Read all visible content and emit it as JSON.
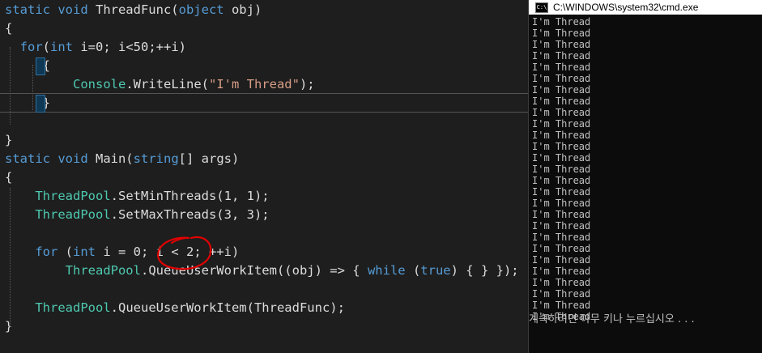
{
  "editor": {
    "lines": [
      [
        {
          "t": "static void ",
          "c": "kw"
        },
        {
          "t": "ThreadFunc(",
          "c": "plain"
        },
        {
          "t": "object",
          "c": "kw"
        },
        {
          "t": " obj)",
          "c": "plain"
        }
      ],
      [
        {
          "t": "{",
          "c": "plain"
        }
      ],
      [
        {
          "t": "  ",
          "c": "plain"
        },
        {
          "t": "for",
          "c": "kw"
        },
        {
          "t": "(",
          "c": "plain"
        },
        {
          "t": "int",
          "c": "kw"
        },
        {
          "t": " i=0; i<50;++i)",
          "c": "plain"
        }
      ],
      [
        {
          "t": "     {",
          "c": "plain"
        }
      ],
      [
        {
          "t": "         ",
          "c": "plain"
        },
        {
          "t": "Console",
          "c": "type"
        },
        {
          "t": ".WriteLine(",
          "c": "plain"
        },
        {
          "t": "\"I'm Thread\"",
          "c": "str"
        },
        {
          "t": ");",
          "c": "plain"
        }
      ],
      [
        {
          "t": "     }",
          "c": "plain"
        }
      ],
      [],
      [
        {
          "t": "}",
          "c": "plain"
        }
      ],
      [
        {
          "t": "static void ",
          "c": "kw"
        },
        {
          "t": "Main(",
          "c": "plain"
        },
        {
          "t": "string",
          "c": "kw"
        },
        {
          "t": "[] args)",
          "c": "plain"
        }
      ],
      [
        {
          "t": "{",
          "c": "plain"
        }
      ],
      [
        {
          "t": "    ",
          "c": "plain"
        },
        {
          "t": "ThreadPool",
          "c": "type"
        },
        {
          "t": ".SetMinThreads(1, 1);",
          "c": "plain"
        }
      ],
      [
        {
          "t": "    ",
          "c": "plain"
        },
        {
          "t": "ThreadPool",
          "c": "type"
        },
        {
          "t": ".SetMaxThreads(3, 3);",
          "c": "plain"
        }
      ],
      [],
      [
        {
          "t": "    ",
          "c": "plain"
        },
        {
          "t": "for",
          "c": "kw"
        },
        {
          "t": " (",
          "c": "plain"
        },
        {
          "t": "int",
          "c": "kw"
        },
        {
          "t": " i = 0; i < 2; ++i)",
          "c": "plain"
        }
      ],
      [
        {
          "t": "        ",
          "c": "plain"
        },
        {
          "t": "ThreadPool",
          "c": "type"
        },
        {
          "t": ".QueueUserWorkItem((obj) => { ",
          "c": "plain"
        },
        {
          "t": "while",
          "c": "kw"
        },
        {
          "t": " (",
          "c": "plain"
        },
        {
          "t": "true",
          "c": "kw"
        },
        {
          "t": ") { } });",
          "c": "plain"
        }
      ],
      [],
      [
        {
          "t": "    ",
          "c": "plain"
        },
        {
          "t": "ThreadPool",
          "c": "type"
        },
        {
          "t": ".QueueUserWorkItem(ThreadFunc);",
          "c": "plain"
        }
      ],
      [
        {
          "t": "}",
          "c": "plain"
        }
      ]
    ],
    "colors": {
      "background": "#1e1e1e",
      "keyword": "#569cd6",
      "type": "#4ec9b0",
      "string": "#d69d85",
      "text": "#dcdcdc",
      "annotation": "#e00000"
    }
  },
  "console": {
    "title": "C:\\WINDOWS\\system32\\cmd.exe",
    "icon": "cmd-icon",
    "output_line": "I'm Thread",
    "output_count": 27,
    "prompt": "계속하려면 아무 키나 누르십시오 . . ."
  }
}
